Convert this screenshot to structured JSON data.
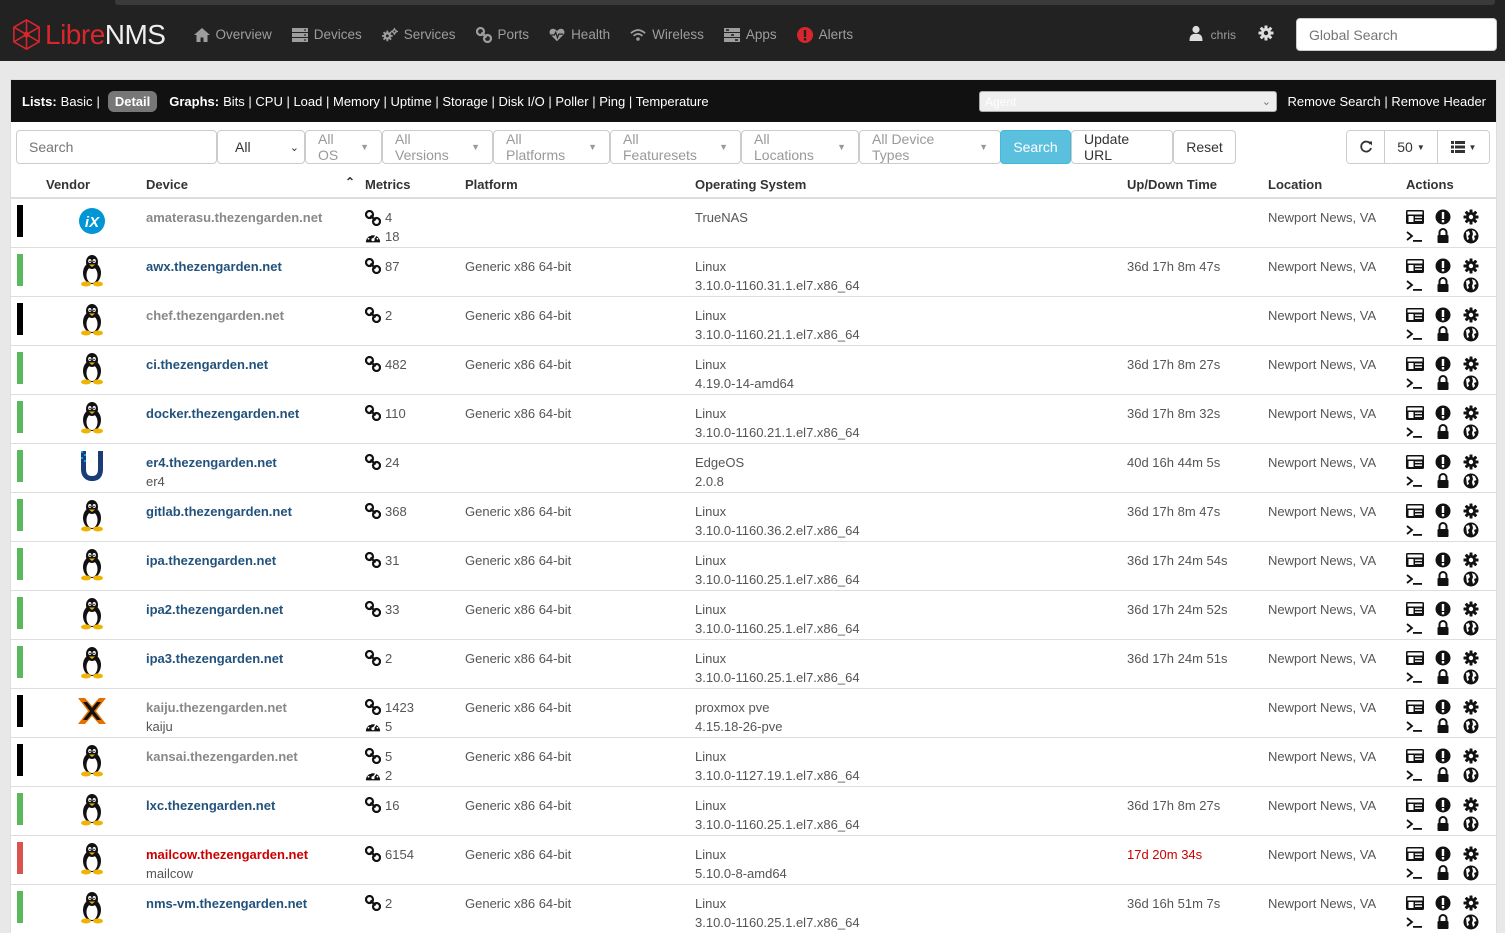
{
  "nav": {
    "brand_libre": "Libre",
    "brand_nms": "NMS",
    "items": [
      {
        "label": "Overview",
        "icon": "home-icon"
      },
      {
        "label": "Devices",
        "icon": "server-icon"
      },
      {
        "label": "Services",
        "icon": "cogs-icon"
      },
      {
        "label": "Ports",
        "icon": "link-icon"
      },
      {
        "label": "Health",
        "icon": "heartbeat-icon"
      },
      {
        "label": "Wireless",
        "icon": "wifi-icon"
      },
      {
        "label": "Apps",
        "icon": "tasks-icon"
      },
      {
        "label": "Alerts",
        "icon": "alert-icon"
      }
    ],
    "user": "chris",
    "search_placeholder": "Global Search"
  },
  "panel": {
    "lists_label": "Lists:",
    "basic_label": "Basic",
    "detail_label": "Detail",
    "graphs_label": "Graphs:",
    "graph_links": [
      "Bits",
      "CPU",
      "Load",
      "Memory",
      "Uptime",
      "Storage",
      "Disk I/O",
      "Poller",
      "Ping",
      "Temperature"
    ],
    "agent_placeholder": "Agent",
    "remove_search": "Remove Search",
    "remove_header": "Remove Header"
  },
  "filters": {
    "search_placeholder": "Search",
    "state": "All",
    "os": "All OS",
    "versions": "All Versions",
    "platforms": "All Platforms",
    "featuresets": "All Featuresets",
    "locations": "All Locations",
    "device_types": "All Device Types",
    "search_btn": "Search",
    "update_url_btn": "Update URL",
    "reset_btn": "Reset",
    "page_size": "50"
  },
  "table": {
    "headers": {
      "vendor": "Vendor",
      "device": "Device",
      "metrics": "Metrics",
      "platform": "Platform",
      "os": "Operating System",
      "uptime": "Up/Down Time",
      "location": "Location",
      "actions": "Actions"
    },
    "rows": [
      {
        "status": "ignored",
        "vendor": "truenas",
        "device": "amaterasu.thezengarden.net",
        "sub": "",
        "ports": "4",
        "sensors": "18",
        "platform": "",
        "os": "TrueNAS",
        "version": "",
        "uptime": "",
        "location": "Newport News, VA"
      },
      {
        "status": "up",
        "vendor": "linux",
        "device": "awx.thezengarden.net",
        "sub": "",
        "ports": "87",
        "sensors": "",
        "platform": "Generic x86 64-bit",
        "os": "Linux",
        "version": "3.10.0-1160.31.1.el7.x86_64",
        "uptime": "36d 17h 8m 47s",
        "location": "Newport News, VA"
      },
      {
        "status": "ignored",
        "vendor": "linux",
        "device": "chef.thezengarden.net",
        "sub": "",
        "ports": "2",
        "sensors": "",
        "platform": "Generic x86 64-bit",
        "os": "Linux",
        "version": "3.10.0-1160.21.1.el7.x86_64",
        "uptime": "",
        "location": "Newport News, VA"
      },
      {
        "status": "up",
        "vendor": "linux",
        "device": "ci.thezengarden.net",
        "sub": "",
        "ports": "482",
        "sensors": "",
        "platform": "Generic x86 64-bit",
        "os": "Linux",
        "version": "4.19.0-14-amd64",
        "uptime": "36d 17h 8m 27s",
        "location": "Newport News, VA"
      },
      {
        "status": "up",
        "vendor": "linux",
        "device": "docker.thezengarden.net",
        "sub": "",
        "ports": "110",
        "sensors": "",
        "platform": "Generic x86 64-bit",
        "os": "Linux",
        "version": "3.10.0-1160.21.1.el7.x86_64",
        "uptime": "36d 17h 8m 32s",
        "location": "Newport News, VA"
      },
      {
        "status": "up",
        "vendor": "ubiquiti",
        "device": "er4.thezengarden.net",
        "sub": "er4",
        "ports": "24",
        "sensors": "",
        "platform": "",
        "os": "EdgeOS",
        "version": "2.0.8",
        "uptime": "40d 16h 44m 5s",
        "location": "Newport News, VA"
      },
      {
        "status": "up",
        "vendor": "linux",
        "device": "gitlab.thezengarden.net",
        "sub": "",
        "ports": "368",
        "sensors": "",
        "platform": "Generic x86 64-bit",
        "os": "Linux",
        "version": "3.10.0-1160.36.2.el7.x86_64",
        "uptime": "36d 17h 8m 47s",
        "location": "Newport News, VA"
      },
      {
        "status": "up",
        "vendor": "linux",
        "device": "ipa.thezengarden.net",
        "sub": "",
        "ports": "31",
        "sensors": "",
        "platform": "Generic x86 64-bit",
        "os": "Linux",
        "version": "3.10.0-1160.25.1.el7.x86_64",
        "uptime": "36d 17h 24m 54s",
        "location": "Newport News, VA"
      },
      {
        "status": "up",
        "vendor": "linux",
        "device": "ipa2.thezengarden.net",
        "sub": "",
        "ports": "33",
        "sensors": "",
        "platform": "Generic x86 64-bit",
        "os": "Linux",
        "version": "3.10.0-1160.25.1.el7.x86_64",
        "uptime": "36d 17h 24m 52s",
        "location": "Newport News, VA"
      },
      {
        "status": "up",
        "vendor": "linux",
        "device": "ipa3.thezengarden.net",
        "sub": "",
        "ports": "2",
        "sensors": "",
        "platform": "Generic x86 64-bit",
        "os": "Linux",
        "version": "3.10.0-1160.25.1.el7.x86_64",
        "uptime": "36d 17h 24m 51s",
        "location": "Newport News, VA"
      },
      {
        "status": "ignored",
        "vendor": "proxmox",
        "device": "kaiju.thezengarden.net",
        "sub": "kaiju",
        "ports": "1423",
        "sensors": "5",
        "platform": "Generic x86 64-bit",
        "os": "proxmox pve",
        "version": "4.15.18-26-pve",
        "uptime": "",
        "location": "Newport News, VA"
      },
      {
        "status": "ignored",
        "vendor": "linux",
        "device": "kansai.thezengarden.net",
        "sub": "",
        "ports": "5",
        "sensors": "2",
        "platform": "Generic x86 64-bit",
        "os": "Linux",
        "version": "3.10.0-1127.19.1.el7.x86_64",
        "uptime": "",
        "location": "Newport News, VA"
      },
      {
        "status": "up",
        "vendor": "linux",
        "device": "lxc.thezengarden.net",
        "sub": "",
        "ports": "16",
        "sensors": "",
        "platform": "Generic x86 64-bit",
        "os": "Linux",
        "version": "3.10.0-1160.25.1.el7.x86_64",
        "uptime": "36d 17h 8m 27s",
        "location": "Newport News, VA"
      },
      {
        "status": "down",
        "vendor": "linux",
        "device": "mailcow.thezengarden.net",
        "sub": "mailcow",
        "ports": "6154",
        "sensors": "",
        "platform": "Generic x86 64-bit",
        "os": "Linux",
        "version": "5.10.0-8-amd64",
        "uptime": "17d 20m 34s",
        "location": "Newport News, VA"
      },
      {
        "status": "up",
        "vendor": "linux",
        "device": "nms-vm.thezengarden.net",
        "sub": "",
        "ports": "2",
        "sensors": "",
        "platform": "Generic x86 64-bit",
        "os": "Linux",
        "version": "3.10.0-1160.25.1.el7.x86_64",
        "uptime": "36d 16h 51m 7s",
        "location": "Newport News, VA"
      }
    ]
  },
  "colors": {
    "navbar_bg": "#222222",
    "brand_red": "#d9262c",
    "status_up": "#5cb85c",
    "status_down": "#d9534f",
    "status_ignored": "#000000",
    "link": "#23527c",
    "search_button": "#5bc0de"
  }
}
